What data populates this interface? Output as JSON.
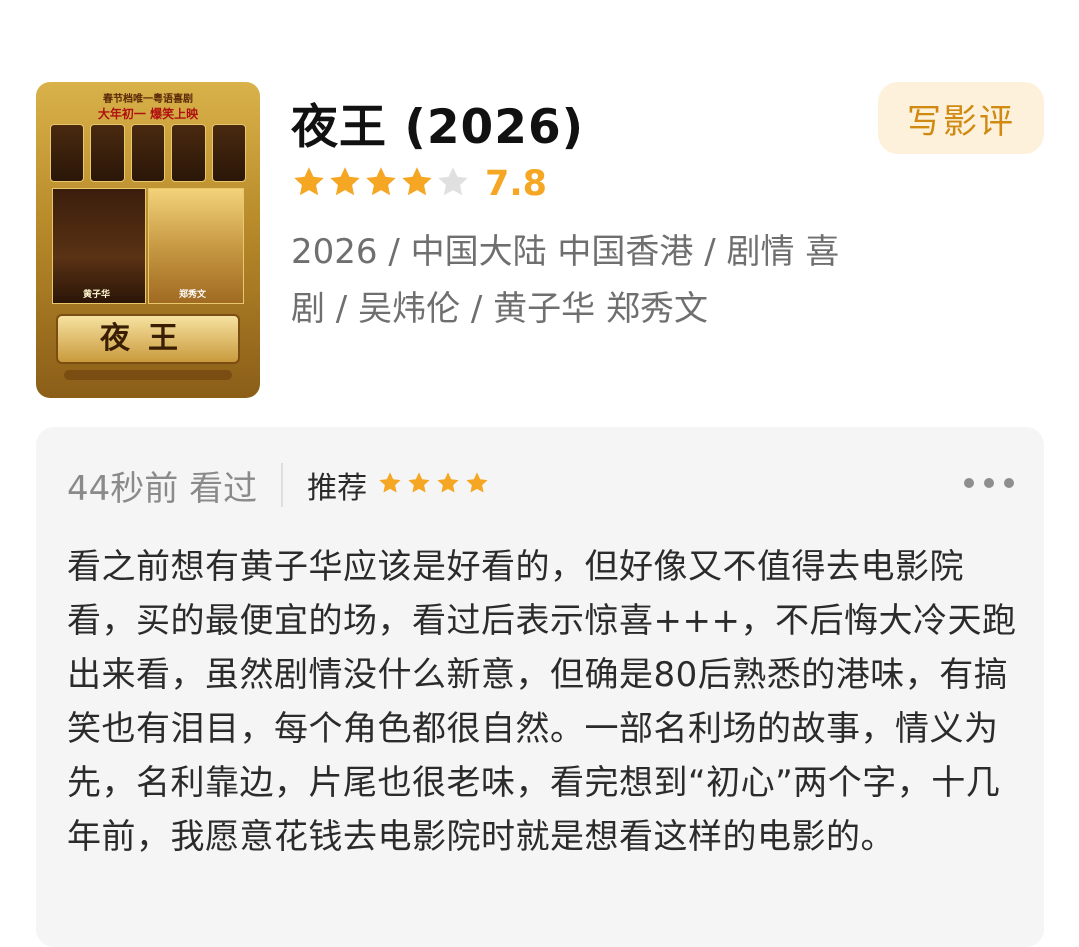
{
  "movie": {
    "title": "夜王 (2026)",
    "rating_value": "7.8",
    "rating_stars": 4,
    "rating_max": 5,
    "meta": "2026 / 中国大陆 中国香港 / 剧情 喜剧 / 吴炜伦 / 黄子华 郑秀文",
    "write_review_label": "写影评",
    "poster": {
      "banner_line1": "春节档唯一粤语喜剧",
      "banner_line2": "大年初一 爆笑上映",
      "actor_left": "黄子华",
      "actor_right": "郑秀文",
      "logo_text": "夜王"
    }
  },
  "review": {
    "time_status": "44秒前 看过",
    "verdict": "推荐",
    "stars": 4,
    "body": "看之前想有黄子华应该是好看的，但好像又不值得去电影院看，买的最便宜的场，看过后表示惊喜+++，不后悔大冷天跑出来看，虽然剧情没什么新意，但确是80后熟悉的港味，有搞笑也有泪目，每个角色都很自然。一部名利场的故事，情义为先，名利靠边，片尾也很老味，看完想到“初心”两个字，十几年前，我愿意花钱去电影院时就是想看这样的电影的。"
  },
  "colors": {
    "star_active": "#f5a623",
    "star_inactive": "#e0e0e0",
    "accent_text": "#d08a12",
    "accent_bg": "#fdf1dc",
    "card_bg": "#f5f5f5"
  },
  "icons": {
    "more": "more-horizontal-icon",
    "star": "star-icon"
  }
}
